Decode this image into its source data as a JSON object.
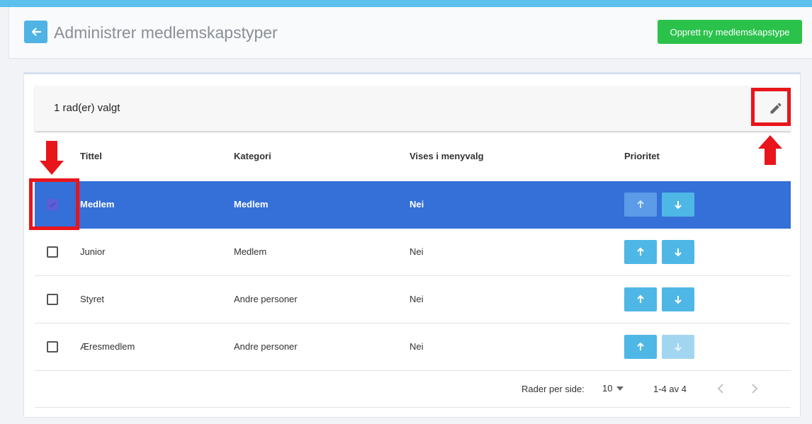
{
  "header": {
    "title": "Administrer medlemskapstyper",
    "create_label": "Opprett ny medlemskapstype"
  },
  "toolbar": {
    "selected_text": "1 rad(er) valgt"
  },
  "table": {
    "columns": [
      "Tittel",
      "Kategori",
      "Vises i menyvalg",
      "Prioritet"
    ],
    "rows": [
      {
        "title": "Medlem",
        "category": "Medlem",
        "menu": "Nei",
        "selected": true
      },
      {
        "title": "Junior",
        "category": "Medlem",
        "menu": "Nei",
        "selected": false
      },
      {
        "title": "Styret",
        "category": "Andre personer",
        "menu": "Nei",
        "selected": false
      },
      {
        "title": "Æresmedlem",
        "category": "Andre personer",
        "menu": "Nei",
        "selected": false
      }
    ]
  },
  "pagination": {
    "rows_per_page_label": "Rader per side:",
    "rows_per_page": "10",
    "range": "1-4 av 4"
  },
  "icons": {
    "back": "arrow-left-icon",
    "edit": "pencil-icon",
    "up": "arrow-up-icon",
    "down": "arrow-down-icon",
    "prev": "chevron-left-icon",
    "next": "chevron-right-icon"
  },
  "colors": {
    "accent": "#4fb7e6",
    "primary_button": "#2bc24c",
    "selected_row": "#356fd8",
    "annotation": "#e8151b"
  }
}
